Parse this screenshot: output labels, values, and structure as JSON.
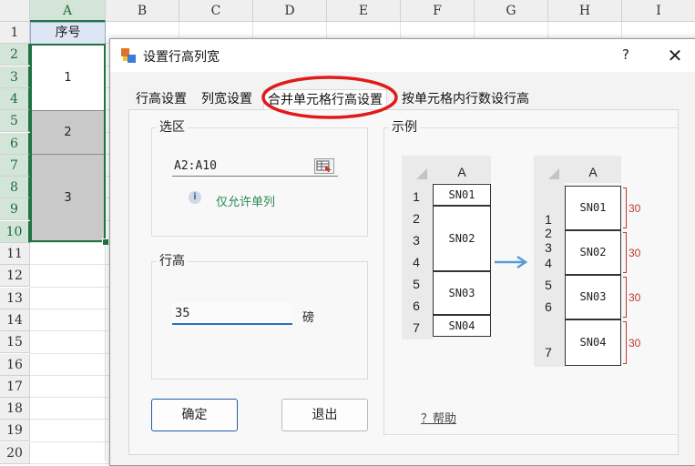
{
  "sheet": {
    "columns": [
      "A",
      "B",
      "C",
      "D",
      "E",
      "F",
      "G",
      "H",
      "I"
    ],
    "rows": [
      "1",
      "2",
      "3",
      "4",
      "5",
      "6",
      "7",
      "8",
      "9",
      "10",
      "11",
      "12",
      "13",
      "14",
      "15",
      "16",
      "17",
      "18",
      "19",
      "20"
    ],
    "header_cell": "序号",
    "merged_values": [
      "1",
      "2",
      "3"
    ]
  },
  "dialog": {
    "title": "设置行高列宽",
    "help_glyph": "?",
    "close_glyph": "✕",
    "tabs": [
      "行高设置",
      "列宽设置",
      "合并单元格行高设置",
      "按单元格内行数设行高"
    ],
    "active_tab": "合并单元格行高设置",
    "selection_group": {
      "title": "选区",
      "range_value": "A2:A10",
      "info_text": "仅允许单列"
    },
    "height_group": {
      "title": "行高",
      "value": "35",
      "unit": "磅"
    },
    "example_group": {
      "title": "示例",
      "col_label": "A",
      "left_rows": [
        "1",
        "2",
        "3",
        "4",
        "5",
        "6",
        "7"
      ],
      "left_cells": [
        "SN01",
        "SN02",
        "SN03",
        "SN04"
      ],
      "right_rows": [
        "1",
        "2",
        "3",
        "4",
        "5",
        "6",
        "7"
      ],
      "right_cells": [
        "SN01",
        "SN02",
        "SN03",
        "SN04"
      ],
      "brace_labels": [
        "30",
        "30",
        "30",
        "30"
      ]
    },
    "ok_label": "确定",
    "exit_label": "退出",
    "help_link": "？帮助"
  },
  "colors": {
    "excel_green": "#217346",
    "annotation_red": "#e01b1b",
    "info_green": "#2a8a52",
    "arrow_blue": "#5b9bd5"
  }
}
